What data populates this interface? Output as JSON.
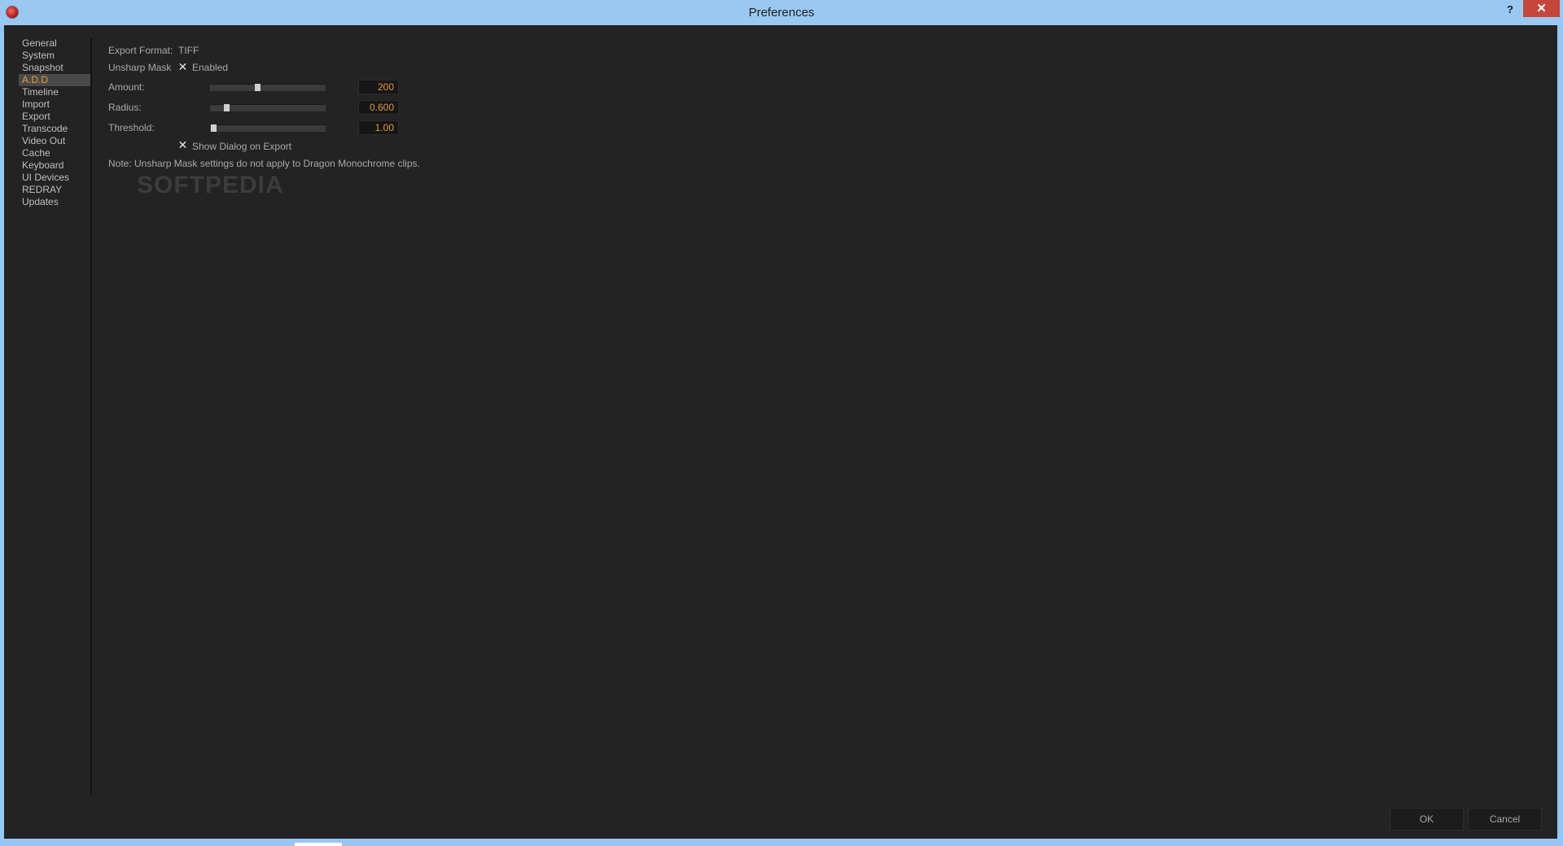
{
  "window": {
    "title": "Preferences",
    "help_label": "?",
    "close_label": "✕"
  },
  "sidebar": {
    "items": [
      {
        "label": "General"
      },
      {
        "label": "System"
      },
      {
        "label": "Snapshot"
      },
      {
        "label": "A.D.D",
        "selected": true
      },
      {
        "label": "Timeline"
      },
      {
        "label": "Import"
      },
      {
        "label": "Export"
      },
      {
        "label": "Transcode"
      },
      {
        "label": "Video Out"
      },
      {
        "label": "Cache"
      },
      {
        "label": "Keyboard"
      },
      {
        "label": "UI Devices"
      },
      {
        "label": "REDRAY"
      },
      {
        "label": "Updates"
      }
    ]
  },
  "export_format": {
    "label": "Export Format:",
    "value": "TIFF"
  },
  "unsharp_mask": {
    "label": "Unsharp Mask",
    "enabled_label": "Enabled",
    "enabled": true
  },
  "sliders": {
    "amount": {
      "label": "Amount:",
      "value": "200",
      "fraction": 0.41
    },
    "radius": {
      "label": "Radius:",
      "value": "0.600",
      "fraction": 0.14
    },
    "threshold": {
      "label": "Threshold:",
      "value": "1.00",
      "fraction": 0.03
    }
  },
  "show_dialog": {
    "label": "Show Dialog on Export",
    "checked": true
  },
  "note": "Note: Unsharp Mask settings do not apply to Dragon Monochrome clips.",
  "watermark": "SOFTPEDIA",
  "buttons": {
    "ok": "OK",
    "cancel": "Cancel"
  },
  "colors": {
    "accent": "#e09a2e",
    "background": "#232323",
    "titlebar": "#99c9f3",
    "close": "#c7453a"
  },
  "icons": {
    "app": "red-app-icon",
    "close": "close-icon",
    "check": "check-x-icon"
  }
}
